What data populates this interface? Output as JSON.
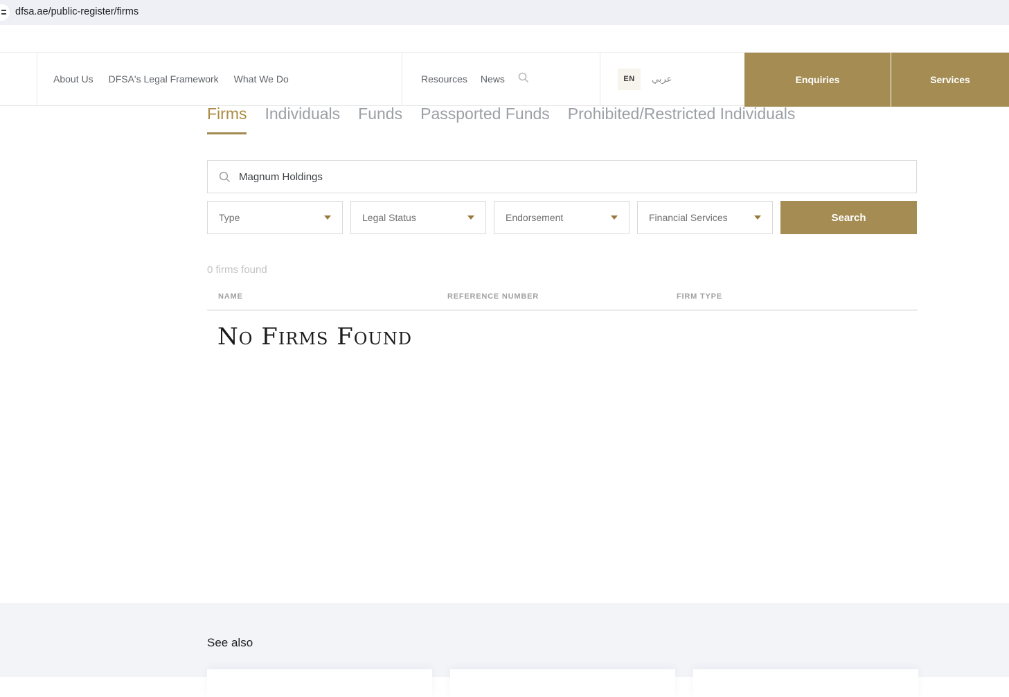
{
  "browser": {
    "url": "dfsa.ae/public-register/firms"
  },
  "nav": {
    "primary": [
      {
        "label": "About Us"
      },
      {
        "label": "DFSA's Legal Framework"
      },
      {
        "label": "What We Do"
      }
    ],
    "secondary": [
      {
        "label": "Resources"
      },
      {
        "label": "News"
      }
    ],
    "language": {
      "current": "EN",
      "alternate": "عربي"
    },
    "actions": [
      {
        "label": "Enquiries"
      },
      {
        "label": "Services"
      }
    ]
  },
  "register_tabs": [
    {
      "label": "Firms",
      "active": true
    },
    {
      "label": "Individuals",
      "active": false
    },
    {
      "label": "Funds",
      "active": false
    },
    {
      "label": "Passported Funds",
      "active": false
    },
    {
      "label": "Prohibited/Restricted Individuals",
      "active": false
    }
  ],
  "search": {
    "value": "Magnum Holdings",
    "button_label": "Search"
  },
  "filters": [
    {
      "label": "Type"
    },
    {
      "label": "Legal Status"
    },
    {
      "label": "Endorsement"
    },
    {
      "label": "Financial Services"
    }
  ],
  "results": {
    "count_text": "0 firms found",
    "columns": [
      {
        "label": "NAME"
      },
      {
        "label": "REFERENCE NUMBER"
      },
      {
        "label": "FIRM TYPE"
      }
    ],
    "empty_message": "No Firms Found"
  },
  "footer": {
    "see_also_title": "See also"
  },
  "colors": {
    "accent_gold": "#a48c52",
    "active_tab_gold": "#ab8c45",
    "urlbar_background": "#eef0f5",
    "footer_background": "#f3f4f8"
  }
}
